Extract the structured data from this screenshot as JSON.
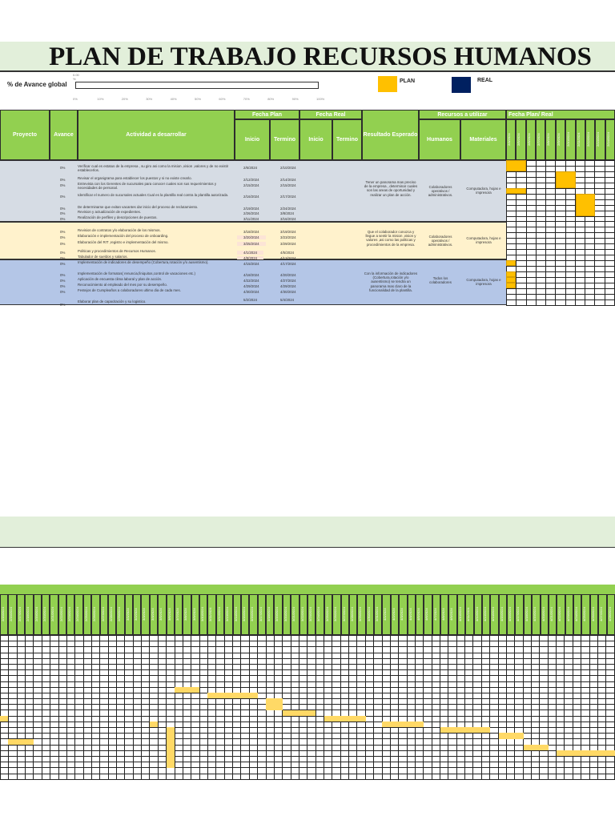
{
  "title": "PLAN DE TRABAJO RECURSOS HUMANOS",
  "progress": {
    "label": "% de Avance global",
    "value_text": "0.00 %",
    "value_percent": 0,
    "ticks": [
      "0%",
      "10%",
      "20%",
      "30%",
      "40%",
      "50%",
      "60%",
      "70%",
      "80%",
      "90%",
      "100%"
    ]
  },
  "legend": [
    {
      "label": "PLAN",
      "color": "#ffc000"
    },
    {
      "label": "REAL",
      "color": "#002060"
    }
  ],
  "table": {
    "headers": {
      "proyecto": "Proyecto",
      "avance": "Avance",
      "actividad": "Actividad a desarrollar",
      "fecha_plan": "Fecha Plan",
      "fecha_real": "Fecha Real",
      "inicio": "Inicio",
      "termino": "Termino",
      "resultado": "Resultado Esperado",
      "recursos": "Recursos a utilizar",
      "humanos": "Humanos",
      "materiales": "Materiales",
      "fecha_plan_real": "Fecha Plan/ Real"
    },
    "date_columns": [
      "2/4/2024",
      "2/5/2024",
      "2/6/2024",
      "2/7/2024",
      "2/8/2024",
      "2/9/2024",
      "2/10/2024",
      "2/11/2024",
      "2/12/2024",
      "2/13/2024",
      "2/14/2024"
    ],
    "sections": [
      {
        "color": "#d6dce4",
        "resultado": "Tener un panorama mas preciso de la empresa , determinar cuales son las areas de oportunidad y realizar un plan de acción.",
        "humanos": "Colaboradores operativos / administrativos.",
        "materiales": "Computadora, hojas e impresora",
        "activities": [
          {
            "avance": "0%",
            "text": "Verificar cual es estatus de la empresa , su giro asi como la mision ,vision ,valores y de no existir establecerlos.",
            "inicio": "2/6/2024",
            "termino": "2/10/2024"
          },
          {
            "avance": "0%",
            "text": "Revisar el organigrama para establecer los puestos y si no existe crearlo.",
            "inicio": "2/12/2024",
            "termino": "2/14/2024"
          },
          {
            "avance": "0%",
            "text": "Entrevista con los Gerentes de sucursales para conocer cuales son sus requerimientos y necesidades de personal.",
            "inicio": "2/15/2024",
            "termino": "2/15/2024"
          },
          {
            "avance": "0%",
            "text": "Identificar el numero de sucursales actuales Cual es la plantilla real contra la plantilla autorizada.",
            "inicio": "2/16/2024",
            "termino": "2/17/2024"
          },
          {
            "avance": "0%",
            "text": "De determinarse que exitan vacantes dar inicio del proceso de reclutamiento.",
            "inicio": "2/19/2024",
            "termino": "2/24/2024"
          },
          {
            "avance": "0%",
            "text": " Revision y actualización de expedientes.",
            "inicio": "2/26/2024",
            "termino": "3/8/2024"
          },
          {
            "avance": "0%",
            "text": "Realización de perfiles y descripciones de puestos.",
            "inicio": "3/11/2024",
            "termino": "3/16/2024"
          }
        ]
      },
      {
        "color": "#fff2cc",
        "resultado": "Que el colaborador conozca y llegue a sentir la mision ,vision y valores ,asi como las politicas y procedimientos de la empresa.",
        "humanos": "Colaboradores operativos / administrativos.",
        "materiales": "Computadora, hojas e impresora",
        "activities": [
          {
            "avance": "0%",
            "text": "Revision de contratos y/o elaboración de los mismos.",
            "inicio": "3/18/2024",
            "termino": "3/19/2024"
          },
          {
            "avance": "0%",
            "text": "Elaboración e implementación del proceso de onboarding.",
            "inicio": "3/20/2024",
            "termino": "3/23/2024"
          },
          {
            "avance": "0%",
            "text": "Elaboración del RIT ,registro e implementación del mismo.",
            "inicio": "3/25/2024",
            "termino": "3/29/2024"
          },
          {
            "avance": "0%",
            "text": "Politicas y procedimientos de Recursos Humanos.",
            "inicio": "4/1/2024",
            "termino": "4/5/2024"
          },
          {
            "avance": "0%",
            "text": "Tabulador de sueldos y salarios.",
            "inicio": "4/8/2024",
            "termino": "4/13/2024"
          }
        ]
      },
      {
        "color": "#b4c6e7",
        "resultado": "Con la información de indicadores (Cobertura,rotación y/o ausentismo) se tendra un panorama mas claro de la funcionalidad de la plantilla.",
        "humanos": "Todos los colaboradores",
        "materiales": "Computadora, hojas e impresora",
        "activities": [
          {
            "avance": "0%",
            "text": "Implementación de indicadores de desempeño (Cobertura,rotación y/o ausentismo).",
            "inicio": "4/15/2024",
            "termino": "4/17/2024"
          },
          {
            "avance": "0%",
            "text": "Implementación de formatos( renuncia,finiquitos,control de vacaciones etc.)",
            "inicio": "4/18/2024",
            "termino": "4/20/2024"
          },
          {
            "avance": "0%",
            "text": "Aplicación de encuesta clima laboral y plan de acción.",
            "inicio": "4/22/2024",
            "termino": "4/27/2024"
          },
          {
            "avance": "0%",
            "text": "Reconocimiento al empleado del mes por su desempeño.",
            "inicio": "4/29/2024",
            "termino": "4/29/2024"
          },
          {
            "avance": "0%",
            "text": "Festejos de Cumpleaños a colaboradores ultimo dia de cada mes.",
            "inicio": "4/30/2024",
            "termino": "4/30/2024"
          },
          {
            "avance": "0%",
            "text": "Elaborar plan de capacitación y su logistico.",
            "inicio": "5/2/2024",
            "termino": "5/4/2024"
          }
        ]
      }
    ]
  },
  "lower_dates": [
    "2/15/2024",
    "2/16/2024",
    "2/17/2024",
    "2/18/2024",
    "2/19/2024",
    "2/20/2024",
    "2/21/2024",
    "2/22/2024",
    "2/23/2024",
    "2/24/2024",
    "2/25/2024",
    "2/26/2024",
    "2/27/2024",
    "2/28/2024",
    "2/29/2024",
    "3/1/2024",
    "3/2/2024",
    "3/3/2024",
    "3/4/2024",
    "3/5/2024",
    "3/6/2024",
    "3/7/2024",
    "3/8/2024",
    "3/9/2024",
    "3/10/2024",
    "3/11/2024",
    "3/12/2024",
    "3/13/2024",
    "3/14/2024",
    "3/15/2024",
    "3/16/2024",
    "3/17/2024",
    "3/18/2024",
    "3/19/2024",
    "3/20/2024",
    "3/21/2024",
    "3/22/2024",
    "3/23/2024",
    "3/24/2024",
    "3/25/2024",
    "3/26/2024",
    "3/27/2024",
    "3/28/2024",
    "3/29/2024",
    "3/30/2024",
    "3/31/2024",
    "4/1/2024",
    "4/2/2024",
    "4/3/2024",
    "4/4/2024",
    "4/5/2024",
    "4/6/2024",
    "4/7/2024",
    "4/8/2024",
    "4/9/2024",
    "4/10/2024",
    "4/11/2024",
    "4/12/2024",
    "4/13/2024",
    "4/14/2024",
    "4/15/2024",
    "4/16/2024",
    "4/17/2024",
    "4/18/2024",
    "4/19/2024",
    "4/20/2024",
    "4/21/2024",
    "4/22/2024",
    "4/23/2024",
    "4/24/2024",
    "4/25/2024",
    "4/26/2024",
    "4/27/2024",
    "4/28/2024"
  ],
  "top_plan_bars": [
    {
      "row": 0,
      "col": 0,
      "span": 2,
      "rows": 2
    },
    {
      "row": 2,
      "col": 5,
      "span": 2,
      "rows": 3
    },
    {
      "row": 5,
      "col": 0,
      "span": 2,
      "rows": 1
    },
    {
      "row": 6,
      "col": 7,
      "span": 2,
      "rows": 4
    },
    {
      "row": 18,
      "col": 0,
      "span": 1,
      "rows": 1
    },
    {
      "row": 20,
      "col": 0,
      "span": 1,
      "rows": 1
    },
    {
      "row": 21,
      "col": 0,
      "span": 1,
      "rows": 1
    },
    {
      "row": 22,
      "col": 0,
      "span": 1,
      "rows": 1
    }
  ],
  "lower_plan_bars": [
    {
      "row": 9,
      "col": 21,
      "span": 3,
      "rows": 1
    },
    {
      "row": 10,
      "col": 25,
      "span": 6,
      "rows": 1
    },
    {
      "row": 11,
      "col": 32,
      "span": 2,
      "rows": 2
    },
    {
      "row": 13,
      "col": 34,
      "span": 4,
      "rows": 1
    },
    {
      "row": 14,
      "col": 0,
      "span": 1,
      "rows": 1
    },
    {
      "row": 14,
      "col": 39,
      "span": 5,
      "rows": 1
    },
    {
      "row": 15,
      "col": 18,
      "span": 1,
      "rows": 1
    },
    {
      "row": 15,
      "col": 46,
      "span": 5,
      "rows": 1
    },
    {
      "row": 16,
      "col": 20,
      "span": 1,
      "rows": 1
    },
    {
      "row": 16,
      "col": 53,
      "span": 6,
      "rows": 1
    },
    {
      "row": 17,
      "col": 20,
      "span": 1,
      "rows": 1
    },
    {
      "row": 17,
      "col": 60,
      "span": 3,
      "rows": 1
    },
    {
      "row": 18,
      "col": 1,
      "span": 3,
      "rows": 1
    },
    {
      "row": 18,
      "col": 20,
      "span": 1,
      "rows": 1
    },
    {
      "row": 19,
      "col": 20,
      "span": 1,
      "rows": 1
    },
    {
      "row": 19,
      "col": 63,
      "span": 3,
      "rows": 1
    },
    {
      "row": 20,
      "col": 20,
      "span": 1,
      "rows": 1
    },
    {
      "row": 20,
      "col": 67,
      "span": 7,
      "rows": 1
    },
    {
      "row": 21,
      "col": 20,
      "span": 1,
      "rows": 1
    },
    {
      "row": 22,
      "col": 20,
      "span": 1,
      "rows": 1
    }
  ]
}
